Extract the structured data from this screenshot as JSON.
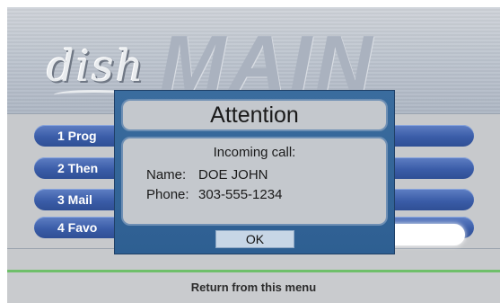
{
  "header": {
    "logo_text": "dish",
    "menu_title": "MAIN"
  },
  "menu": {
    "items": [
      {
        "label": "1 Prog"
      },
      {
        "label": "2 Then"
      },
      {
        "label": "3 Mail"
      },
      {
        "label": "4 Favo"
      }
    ]
  },
  "footer": {
    "return_label": "Return from this menu"
  },
  "dialog": {
    "title": "Attention",
    "message": "Incoming call:",
    "name_label": "Name:",
    "name_value": "DOE JOHN",
    "phone_label": "Phone:",
    "phone_value": "303-555-1234",
    "ok_label": "OK"
  },
  "colors": {
    "dialog_frame": "#2e5f92",
    "menu_pill": "#3b5da8",
    "panel_gray": "#c4c8cd"
  }
}
